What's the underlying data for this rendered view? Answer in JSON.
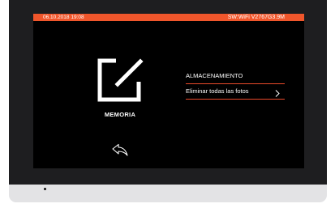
{
  "status_bar": {
    "date_time": "06.10.2018  19:08",
    "firmware": "SW:WiFi V2767G3.9M",
    "accent_color": "#f0562b"
  },
  "tile": {
    "label": "MEMORIA",
    "icon": "edit-icon"
  },
  "menu": {
    "items": [
      {
        "label": "ALMACENAMIENTO",
        "icon": ""
      },
      {
        "label": "Eliminar todas las fotos",
        "icon": "chevron-right-icon"
      }
    ],
    "divider_color": "#ea4a2a"
  },
  "back_button": {
    "icon": "back-arrow-icon"
  }
}
